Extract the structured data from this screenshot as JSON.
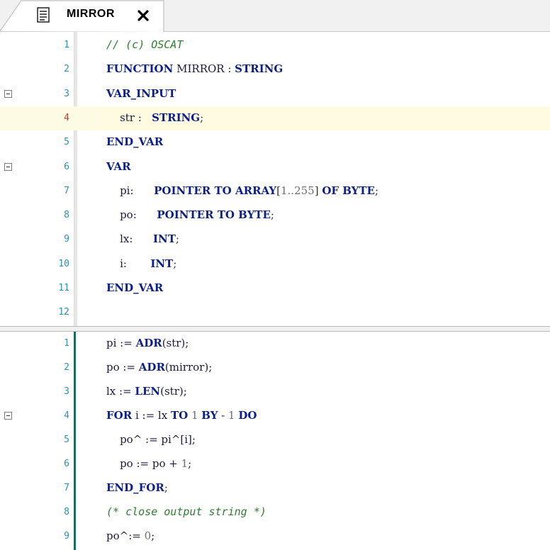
{
  "tab": {
    "label": "MIRROR",
    "icon": "document-icon",
    "close_icon": "close-icon"
  },
  "declaration": {
    "lines": [
      {
        "n": "1",
        "tokens": [
          {
            "t": "// (c) OSCAT",
            "c": "cm"
          }
        ]
      },
      {
        "n": "2",
        "tokens": [
          {
            "t": "FUNCTION",
            "c": "kw"
          },
          {
            "t": " MIRROR : ",
            "c": "id"
          },
          {
            "t": "STRING",
            "c": "kw"
          }
        ]
      },
      {
        "n": "3",
        "fold": true,
        "tokens": [
          {
            "t": "VAR_INPUT",
            "c": "kw"
          }
        ]
      },
      {
        "n": "4",
        "current": true,
        "tokens": [
          {
            "t": "    str :   ",
            "c": "id"
          },
          {
            "t": "STRING",
            "c": "kw"
          },
          {
            "t": ";",
            "c": "op"
          }
        ]
      },
      {
        "n": "5",
        "tokens": [
          {
            "t": "END_VAR",
            "c": "kw"
          }
        ]
      },
      {
        "n": "6",
        "fold": true,
        "tokens": [
          {
            "t": "VAR",
            "c": "kw"
          }
        ]
      },
      {
        "n": "7",
        "tokens": [
          {
            "t": "    pi:      ",
            "c": "id"
          },
          {
            "t": "POINTER TO ARRAY",
            "c": "kw"
          },
          {
            "t": "[",
            "c": "op"
          },
          {
            "t": "1..255",
            "c": "num"
          },
          {
            "t": "] ",
            "c": "op"
          },
          {
            "t": "OF BYTE",
            "c": "kw"
          },
          {
            "t": ";",
            "c": "op"
          }
        ]
      },
      {
        "n": "8",
        "tokens": [
          {
            "t": "    po:      ",
            "c": "id"
          },
          {
            "t": "POINTER TO BYTE",
            "c": "kw"
          },
          {
            "t": ";",
            "c": "op"
          }
        ]
      },
      {
        "n": "9",
        "tokens": [
          {
            "t": "    lx:      ",
            "c": "id"
          },
          {
            "t": "INT",
            "c": "kw"
          },
          {
            "t": ";",
            "c": "op"
          }
        ]
      },
      {
        "n": "10",
        "tokens": [
          {
            "t": "    i:       ",
            "c": "id"
          },
          {
            "t": "INT",
            "c": "kw"
          },
          {
            "t": ";",
            "c": "op"
          }
        ]
      },
      {
        "n": "11",
        "tokens": [
          {
            "t": "END_VAR",
            "c": "kw"
          }
        ]
      },
      {
        "n": "12",
        "tokens": []
      }
    ]
  },
  "implementation": {
    "lines": [
      {
        "n": "1",
        "tokens": [
          {
            "t": "pi := ",
            "c": "id"
          },
          {
            "t": "ADR",
            "c": "kw"
          },
          {
            "t": "(str);",
            "c": "id"
          }
        ]
      },
      {
        "n": "2",
        "tokens": [
          {
            "t": "po := ",
            "c": "id"
          },
          {
            "t": "ADR",
            "c": "kw"
          },
          {
            "t": "(mirror);",
            "c": "id"
          }
        ]
      },
      {
        "n": "3",
        "tokens": [
          {
            "t": "lx := ",
            "c": "id"
          },
          {
            "t": "LEN",
            "c": "kw"
          },
          {
            "t": "(str);",
            "c": "id"
          }
        ]
      },
      {
        "n": "4",
        "fold": true,
        "tokens": [
          {
            "t": "FOR",
            "c": "kw"
          },
          {
            "t": " i := lx ",
            "c": "id"
          },
          {
            "t": "TO",
            "c": "kw"
          },
          {
            "t": " ",
            "c": "id"
          },
          {
            "t": "1",
            "c": "num"
          },
          {
            "t": " ",
            "c": "id"
          },
          {
            "t": "BY",
            "c": "kw"
          },
          {
            "t": " - ",
            "c": "id"
          },
          {
            "t": "1",
            "c": "num"
          },
          {
            "t": " ",
            "c": "id"
          },
          {
            "t": "DO",
            "c": "kw"
          }
        ]
      },
      {
        "n": "5",
        "tokens": [
          {
            "t": "    po^ := pi^[i];",
            "c": "id"
          }
        ]
      },
      {
        "n": "6",
        "tokens": [
          {
            "t": "    po := po + ",
            "c": "id"
          },
          {
            "t": "1",
            "c": "num"
          },
          {
            "t": ";",
            "c": "id"
          }
        ]
      },
      {
        "n": "7",
        "tokens": [
          {
            "t": "END_FOR",
            "c": "kw"
          },
          {
            "t": ";",
            "c": "op"
          }
        ]
      },
      {
        "n": "8",
        "tokens": [
          {
            "t": "(* close output string *)",
            "c": "cm"
          }
        ]
      },
      {
        "n": "9",
        "tokens": [
          {
            "t": "po^:= ",
            "c": "id"
          },
          {
            "t": "0",
            "c": "num"
          },
          {
            "t": ";",
            "c": "id"
          }
        ]
      }
    ]
  }
}
